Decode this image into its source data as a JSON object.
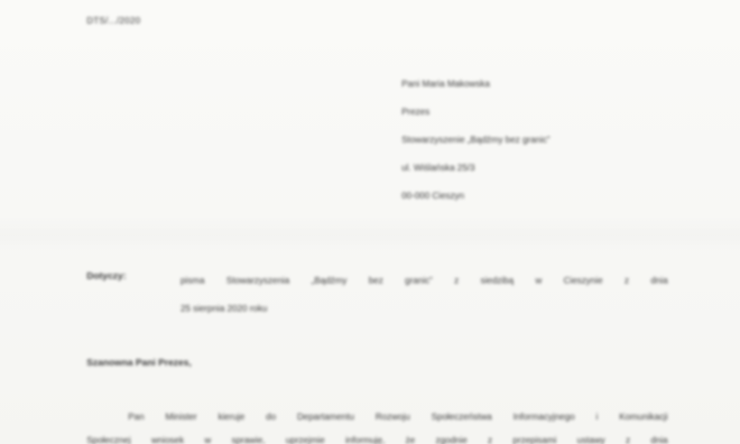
{
  "document": {
    "reference": "DTS/.../2020",
    "addressee": {
      "lines": [
        "Pani Maria Makowska",
        "Prezes",
        "Stowarzyszenie „Bądźmy bez granic”",
        "ul. Wiślańska 25/3",
        "00-000 Cieszyn"
      ]
    },
    "subject": {
      "label": "Dotyczy:",
      "line1": "pisma Stowarzyszenia „Bądźmy bez granic” z siedzibą w Cieszynie z dnia",
      "line2": "25 sierpnia 2020 roku"
    },
    "salutation": "Szanowna Pani Prezes,",
    "body": {
      "line1": "Pan Minister kieruje do Departamentu Rozwoju Społeczeństwa Informacyjnego i Komunikacji",
      "line2": "Społecznej wniosek w sprawie, uprzejmie informuję, że zgodnie z przepisami ustawy z dnia"
    }
  }
}
